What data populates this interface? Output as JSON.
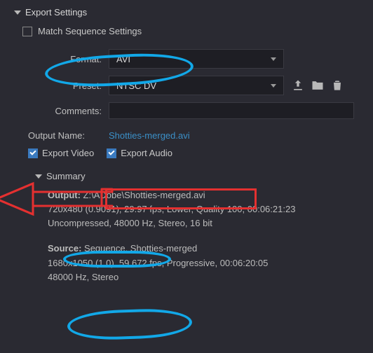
{
  "section_title": "Export Settings",
  "match_sequence": {
    "label": "Match Sequence Settings",
    "checked": false
  },
  "format": {
    "label": "Format:",
    "value": "AVI"
  },
  "preset": {
    "label": "Preset:",
    "value": "NTSC DV"
  },
  "comments": {
    "label": "Comments:",
    "value": ""
  },
  "output_name": {
    "label": "Output Name:",
    "value": "Shotties-merged.avi"
  },
  "export_video": {
    "label": "Export Video",
    "checked": true
  },
  "export_audio": {
    "label": "Export Audio",
    "checked": true
  },
  "summary": {
    "title": "Summary",
    "output": {
      "label": "Output:",
      "path": "Z:\\ADobe\\Shotties-merged.avi",
      "line1": "720x480 (0.9091), 29.97 fps, Lower, Quality 100, 00:06:21:23",
      "line2": "Uncompressed, 48000 Hz, Stereo, 16 bit"
    },
    "source": {
      "label": "Source:",
      "path": "Sequence, Shotties-merged",
      "line1": "1680x1050 (1.0), 59.672 fps, Progressive, 00:06:20:05",
      "line2": "48000 Hz, Stereo"
    }
  },
  "icons": {
    "save": "save-preset",
    "import": "import-preset",
    "trash": "delete-preset"
  }
}
